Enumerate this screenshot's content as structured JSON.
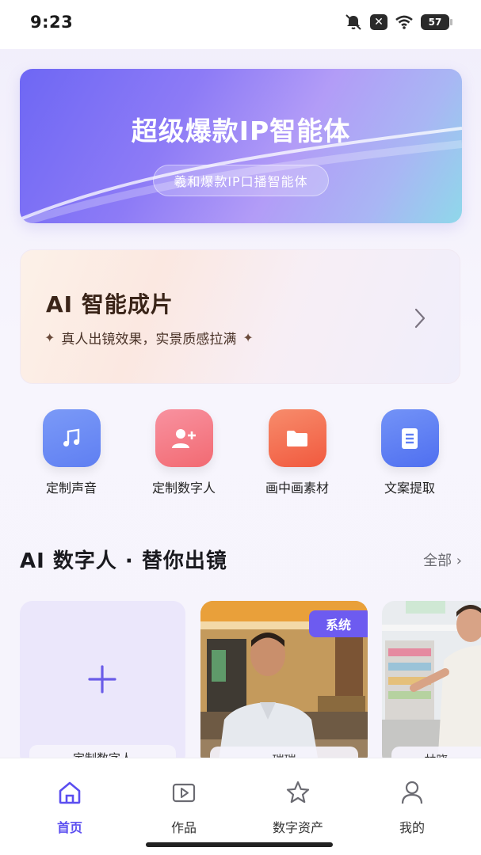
{
  "status_bar": {
    "time": "9:23",
    "battery": "57",
    "icons": [
      "mute-icon",
      "x-icon",
      "wifi-icon",
      "battery-icon"
    ]
  },
  "banner": {
    "title": "超级爆款IP智能体",
    "subtitle": "羲和爆款IP口播智能体"
  },
  "ai_card": {
    "title": "AI 智能成片",
    "description": "真人出镜效果，实景质感拉满"
  },
  "features": [
    {
      "label": "定制声音",
      "icon": "music-note-icon",
      "color": "#6f8df5"
    },
    {
      "label": "定制数字人",
      "icon": "add-user-icon",
      "color": "#f47a86"
    },
    {
      "label": "画中画素材",
      "icon": "folder-icon",
      "color": "#f36f56"
    },
    {
      "label": "文案提取",
      "icon": "document-icon",
      "color": "#5f7ff4"
    }
  ],
  "section": {
    "title": "AI 数字人 · 替你出镜",
    "more": "全部 ›"
  },
  "cards": {
    "add_caption": "定制数字人",
    "system_tag": "系统",
    "person1_caption": "瑞瑞",
    "person2_caption": "林晓"
  },
  "nav": [
    {
      "label": "首页",
      "icon": "home-icon",
      "active": true
    },
    {
      "label": "作品",
      "icon": "video-icon",
      "active": false
    },
    {
      "label": "数字资产",
      "icon": "star-icon",
      "active": false
    },
    {
      "label": "我的",
      "icon": "user-icon",
      "active": false
    }
  ],
  "colors": {
    "accent": "#5b4ef0",
    "system_tag": "#6d5bf0"
  }
}
